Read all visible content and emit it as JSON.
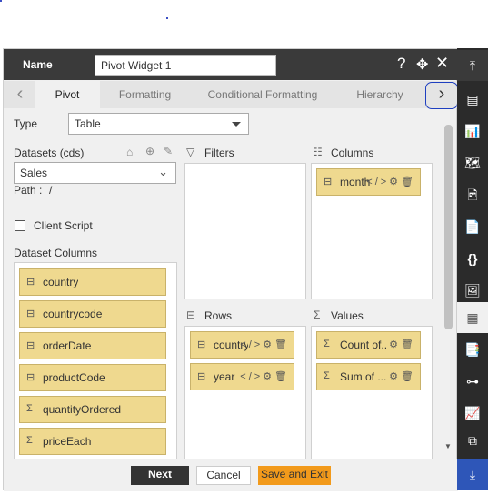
{
  "header": {
    "name_label": "Name",
    "name_value": "Pivot Widget 1"
  },
  "tabs": [
    {
      "label": "Pivot"
    },
    {
      "label": "Formatting"
    },
    {
      "label": "Conditional Formatting"
    },
    {
      "label": "Hierarchy"
    }
  ],
  "type": {
    "label": "Type",
    "value": "Table"
  },
  "datasets": {
    "label": "Datasets (cds)",
    "value": "Sales",
    "path_label": "Path :",
    "path_value": "/"
  },
  "client_script": {
    "label": "Client Script",
    "checked": false
  },
  "dataset_columns": {
    "label": "Dataset Columns",
    "items": [
      {
        "icon": "table-icon",
        "label": "country"
      },
      {
        "icon": "table-icon",
        "label": "countrycode"
      },
      {
        "icon": "table-icon",
        "label": "orderDate"
      },
      {
        "icon": "table-icon",
        "label": "productCode"
      },
      {
        "icon": "sigma-icon",
        "label": "quantityOrdered"
      },
      {
        "icon": "sigma-icon",
        "label": "priceEach"
      }
    ]
  },
  "filters": {
    "label": "Filters",
    "items": []
  },
  "columns": {
    "label": "Columns",
    "items": [
      {
        "label": "month"
      }
    ]
  },
  "rows": {
    "label": "Rows",
    "items": [
      {
        "label": "country"
      },
      {
        "label": "year"
      }
    ]
  },
  "values": {
    "label": "Values",
    "items": [
      {
        "label": "Count of..."
      },
      {
        "label": "Sum of ..."
      }
    ]
  },
  "footer": {
    "next": "Next",
    "cancel": "Cancel",
    "save_exit": "Save and Exit"
  },
  "colors": {
    "header_bg": "#3a3a3a",
    "chip_bg": "#efd98f",
    "save_btn": "#f29a1b",
    "rail_bg": "#2b2b2b",
    "rail_accent": "#2e56b8",
    "annotation": "#1e3fc0"
  },
  "rail_icons": [
    "arrow-up-bar-icon",
    "table-widget-icon",
    "chart-icon",
    "map-icon",
    "image-doc-icon",
    "document-icon",
    "code-braces-icon",
    "picture-icon",
    "pivot-icon",
    "report-icon",
    "hierarchy-icon",
    "line-chart-icon",
    "copy-icon",
    "arrow-down-bar-icon"
  ]
}
